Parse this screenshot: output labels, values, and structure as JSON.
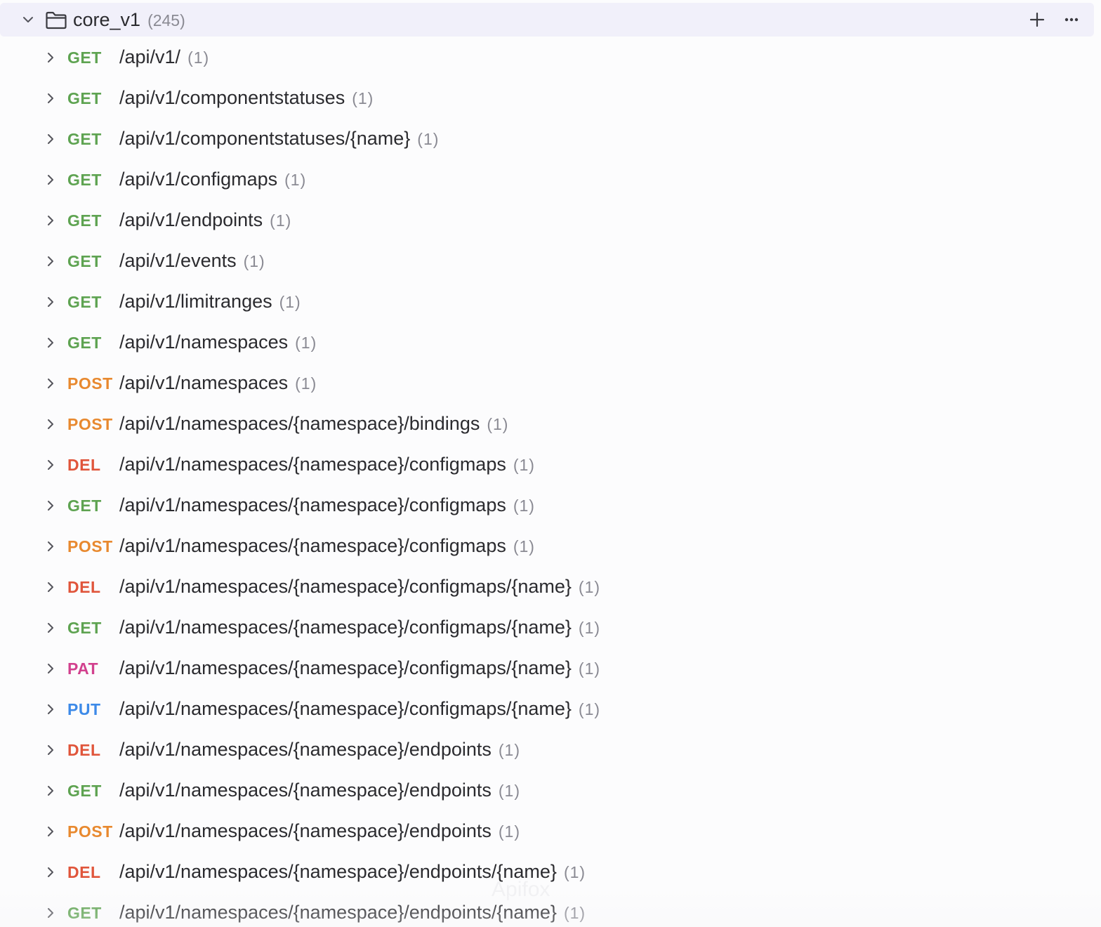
{
  "folder": {
    "name": "core_v1",
    "count": "(245)",
    "chevron_icon": "chevron-down-icon",
    "folder_icon": "folder-icon",
    "add_icon": "plus-icon",
    "more_icon": "more-horizontal-icon"
  },
  "method_colors": {
    "GET": "#5ea351",
    "POST": "#e8892f",
    "DEL": "#e0553b",
    "PAT": "#d2418e",
    "PUT": "#3d8ae8"
  },
  "endpoints": [
    {
      "method": "GET",
      "path": "/api/v1/",
      "count": "(1)"
    },
    {
      "method": "GET",
      "path": "/api/v1/componentstatuses",
      "count": "(1)"
    },
    {
      "method": "GET",
      "path": "/api/v1/componentstatuses/{name}",
      "count": "(1)"
    },
    {
      "method": "GET",
      "path": "/api/v1/configmaps",
      "count": "(1)"
    },
    {
      "method": "GET",
      "path": "/api/v1/endpoints",
      "count": "(1)"
    },
    {
      "method": "GET",
      "path": "/api/v1/events",
      "count": "(1)"
    },
    {
      "method": "GET",
      "path": "/api/v1/limitranges",
      "count": "(1)"
    },
    {
      "method": "GET",
      "path": "/api/v1/namespaces",
      "count": "(1)"
    },
    {
      "method": "POST",
      "path": "/api/v1/namespaces",
      "count": "(1)"
    },
    {
      "method": "POST",
      "path": "/api/v1/namespaces/{namespace}/bindings",
      "count": "(1)"
    },
    {
      "method": "DEL",
      "path": "/api/v1/namespaces/{namespace}/configmaps",
      "count": "(1)"
    },
    {
      "method": "GET",
      "path": "/api/v1/namespaces/{namespace}/configmaps",
      "count": "(1)"
    },
    {
      "method": "POST",
      "path": "/api/v1/namespaces/{namespace}/configmaps",
      "count": "(1)"
    },
    {
      "method": "DEL",
      "path": "/api/v1/namespaces/{namespace}/configmaps/{name}",
      "count": "(1)"
    },
    {
      "method": "GET",
      "path": "/api/v1/namespaces/{namespace}/configmaps/{name}",
      "count": "(1)"
    },
    {
      "method": "PAT",
      "path": "/api/v1/namespaces/{namespace}/configmaps/{name}",
      "count": "(1)"
    },
    {
      "method": "PUT",
      "path": "/api/v1/namespaces/{namespace}/configmaps/{name}",
      "count": "(1)"
    },
    {
      "method": "DEL",
      "path": "/api/v1/namespaces/{namespace}/endpoints",
      "count": "(1)"
    },
    {
      "method": "GET",
      "path": "/api/v1/namespaces/{namespace}/endpoints",
      "count": "(1)"
    },
    {
      "method": "POST",
      "path": "/api/v1/namespaces/{namespace}/endpoints",
      "count": "(1)"
    },
    {
      "method": "DEL",
      "path": "/api/v1/namespaces/{namespace}/endpoints/{name}",
      "count": "(1)"
    },
    {
      "method": "GET",
      "path": "/api/v1/namespaces/{namespace}/endpoints/{name}",
      "count": "(1)"
    }
  ],
  "watermark": "Apifox"
}
